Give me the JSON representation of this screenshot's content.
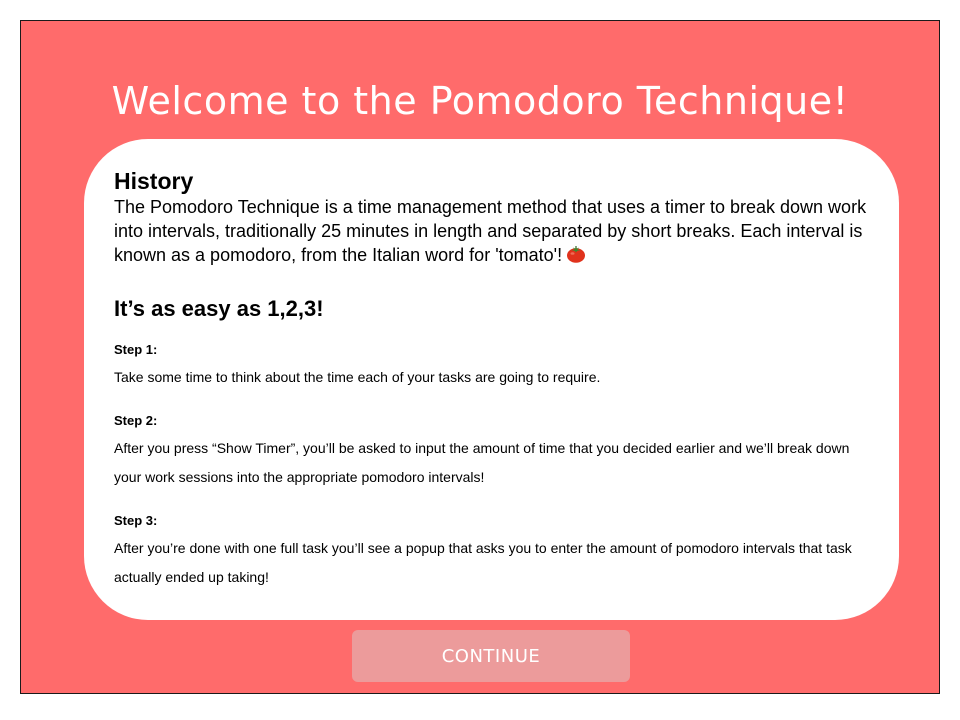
{
  "header": {
    "title": "Welcome to the Pomodoro Technique!"
  },
  "history": {
    "heading": "History",
    "text": "The Pomodoro Technique is a time management method that uses a timer to break down work into intervals, traditionally 25 minutes in length and separated by short breaks. Each interval is known as a pomodoro, from the Italian word for 'tomato'!",
    "icon": "tomato-icon"
  },
  "steps_section": {
    "heading": "It’s as easy as 1,2,3!",
    "steps": [
      {
        "label": "Step 1:",
        "text": "Take some time to think about the time each of your tasks are going to require."
      },
      {
        "label": "Step 2:",
        "text": "After you press “Show Timer”, you’ll be asked to input the amount of time that you decided earlier and we’ll break down your work sessions into the appropriate pomodoro intervals!"
      },
      {
        "label": "Step 3:",
        "text": "After you’re done with one full task you’ll see a popup that asks you to enter the amount of pomodoro intervals that task actually ended up taking!"
      }
    ]
  },
  "actions": {
    "continue_label": "CONTINUE"
  },
  "colors": {
    "background": "#ff6b6b",
    "card": "#ffffff",
    "button": "#ec9b9b"
  }
}
